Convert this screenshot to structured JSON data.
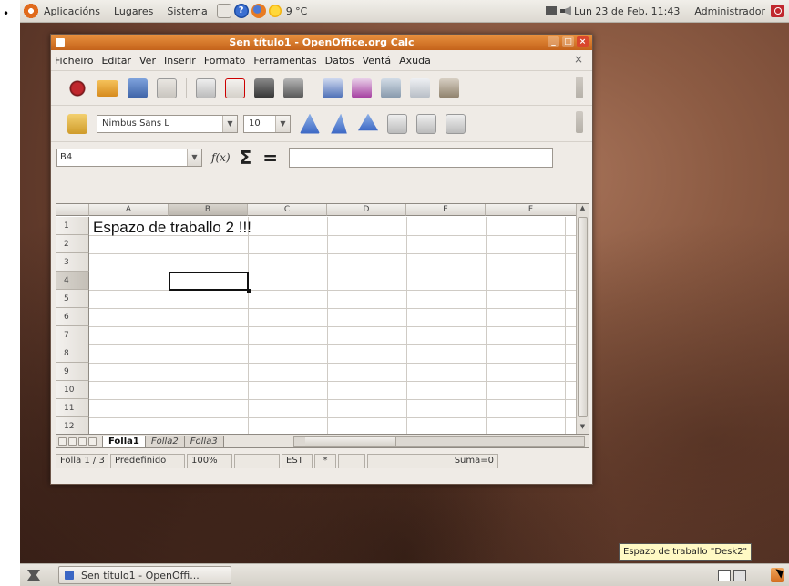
{
  "bullet": "•",
  "top_panel": {
    "menus": [
      "Aplicacións",
      "Lugares",
      "Sistema"
    ],
    "temperature": "9 °C",
    "clock": "Lun 23 de Feb, 11:43",
    "user": "Administrador"
  },
  "window": {
    "title": "Sen título1 - OpenOffice.org Calc",
    "menu": [
      "Ficheiro",
      "Editar",
      "Ver",
      "Inserir",
      "Formato",
      "Ferramentas",
      "Datos",
      "Ventá",
      "Axuda"
    ],
    "doc_close": "×",
    "font_name": "Nimbus Sans L",
    "font_size": "10",
    "name_box": "B4",
    "fx_label": "f(x)",
    "sigma": "Σ",
    "equals": "="
  },
  "sheet": {
    "columns": [
      "A",
      "B",
      "C",
      "D",
      "E",
      "F"
    ],
    "selected_column": "B",
    "rows": [
      "1",
      "2",
      "3",
      "4",
      "5",
      "6",
      "7",
      "8",
      "9",
      "10",
      "11",
      "12"
    ],
    "selected_row": "4",
    "cell_a1": "Espazo de traballo 2 !!!",
    "tabs": [
      "Folla1",
      "Folla2",
      "Folla3"
    ],
    "active_tab": "Folla1"
  },
  "status": {
    "sheet": "Folla 1 / 3",
    "style": "Predefinido",
    "zoom": "100%",
    "mode": "EST",
    "modified": "*",
    "sum": "Suma=0"
  },
  "taskbar": {
    "task_label": "Sen título1 - OpenOffi...",
    "tooltip": "Espazo de traballo \"Desk2\""
  },
  "colors": {
    "titlebar": "#d9772b",
    "desktop": "#7a4b36",
    "tooltip_bg": "#fff9c4"
  }
}
